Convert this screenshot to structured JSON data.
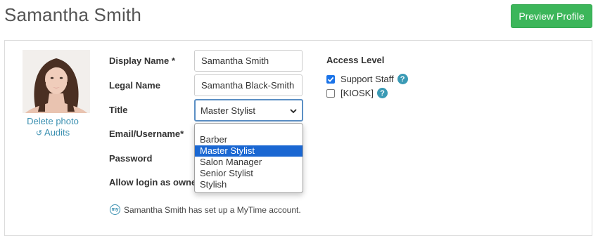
{
  "header": {
    "title": "Samantha Smith",
    "preview_button": "Preview Profile"
  },
  "photo": {
    "delete_link": "Delete photo",
    "audits_link": "Audits"
  },
  "form": {
    "display_name_label": "Display Name *",
    "display_name_value": "Samantha Smith",
    "legal_name_label": "Legal Name",
    "legal_name_value": "Samantha Black-Smith",
    "title_label": "Title",
    "title_selected": "Master Stylist",
    "title_options": [
      "Barber",
      "Master Stylist",
      "Salon Manager",
      "Senior Stylist",
      "Stylish"
    ],
    "email_label": "Email/Username*",
    "password_label": "Password",
    "allow_login_label": "Allow login as owne"
  },
  "access": {
    "title": "Access Level",
    "support_staff": "Support Staff",
    "support_staff_checked": true,
    "kiosk": "[KIOSK]",
    "kiosk_checked": false
  },
  "footer": {
    "icon_text": "my",
    "note": "Samantha Smith has set up a MyTime account."
  },
  "colors": {
    "accent_green": "#3cb65a",
    "link_blue": "#3a8fb0",
    "select_highlight": "#1a67d2"
  }
}
